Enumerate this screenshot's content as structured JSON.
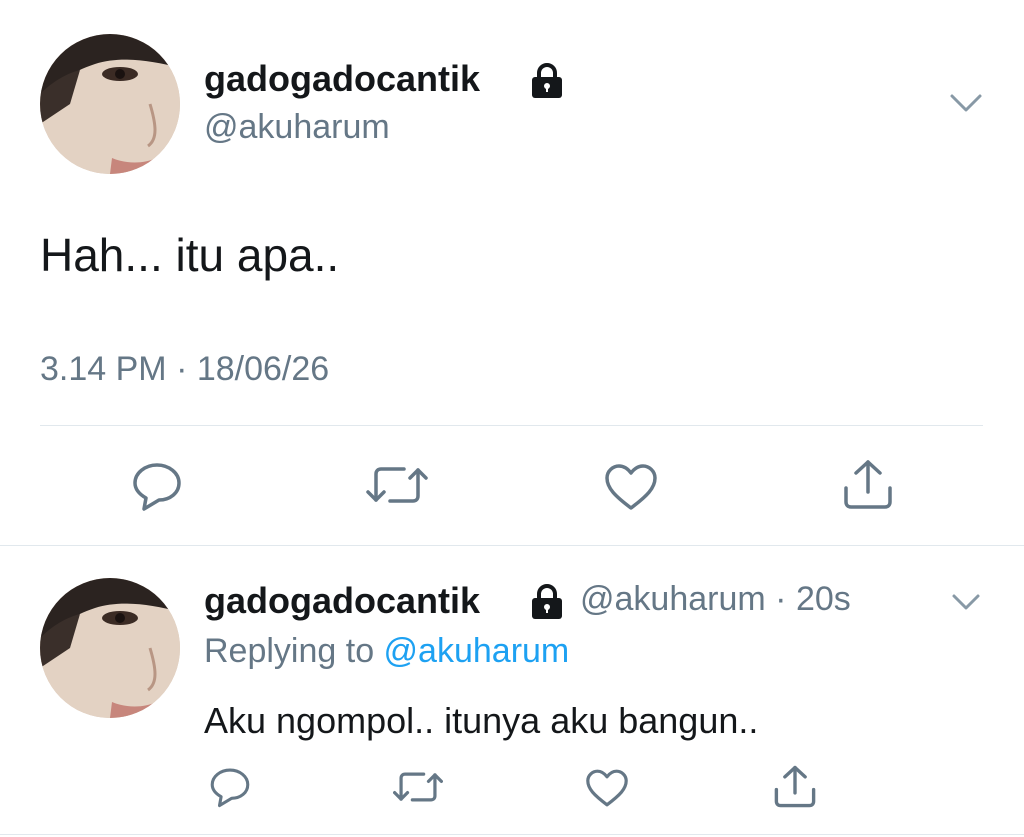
{
  "main_tweet": {
    "display_name": "gadogadocantik",
    "handle": "@akuharum",
    "text": "Hah... itu apa..",
    "time": "3.14 PM",
    "separator": " · ",
    "date": "18/06/26"
  },
  "reply_tweet": {
    "display_name": "gadogadocantik",
    "handle": "@akuharum",
    "age_separator": " · ",
    "age": "20s",
    "replying_prefix": "Replying to ",
    "replying_to": "@akuharum",
    "text": "Aku ngompol.. itunya aku bangun.."
  },
  "icons": {
    "verified_lock": "lock-icon",
    "menu": "chevron-down-icon",
    "actions": [
      "reply-icon",
      "retweet-icon",
      "like-icon",
      "share-icon"
    ]
  },
  "colors": {
    "text": "#14171a",
    "secondary": "#657786",
    "link": "#1da1f2",
    "icon": "#657786",
    "divider": "#e1e8ed"
  }
}
